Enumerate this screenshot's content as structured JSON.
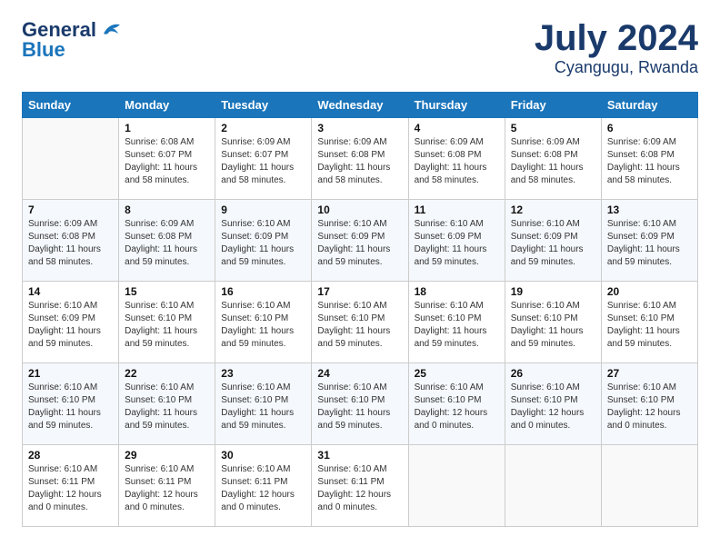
{
  "logo": {
    "general": "General",
    "blue": "Blue",
    "bird_unicode": "🐦"
  },
  "header": {
    "month_year": "July 2024",
    "location": "Cyangugu, Rwanda"
  },
  "days_of_week": [
    "Sunday",
    "Monday",
    "Tuesday",
    "Wednesday",
    "Thursday",
    "Friday",
    "Saturday"
  ],
  "weeks": [
    [
      {
        "day": "",
        "info": ""
      },
      {
        "day": "1",
        "info": "Sunrise: 6:08 AM\nSunset: 6:07 PM\nDaylight: 11 hours\nand 58 minutes."
      },
      {
        "day": "2",
        "info": "Sunrise: 6:09 AM\nSunset: 6:07 PM\nDaylight: 11 hours\nand 58 minutes."
      },
      {
        "day": "3",
        "info": "Sunrise: 6:09 AM\nSunset: 6:08 PM\nDaylight: 11 hours\nand 58 minutes."
      },
      {
        "day": "4",
        "info": "Sunrise: 6:09 AM\nSunset: 6:08 PM\nDaylight: 11 hours\nand 58 minutes."
      },
      {
        "day": "5",
        "info": "Sunrise: 6:09 AM\nSunset: 6:08 PM\nDaylight: 11 hours\nand 58 minutes."
      },
      {
        "day": "6",
        "info": "Sunrise: 6:09 AM\nSunset: 6:08 PM\nDaylight: 11 hours\nand 58 minutes."
      }
    ],
    [
      {
        "day": "7",
        "info": "Sunrise: 6:09 AM\nSunset: 6:08 PM\nDaylight: 11 hours\nand 58 minutes."
      },
      {
        "day": "8",
        "info": "Sunrise: 6:09 AM\nSunset: 6:08 PM\nDaylight: 11 hours\nand 59 minutes."
      },
      {
        "day": "9",
        "info": "Sunrise: 6:10 AM\nSunset: 6:09 PM\nDaylight: 11 hours\nand 59 minutes."
      },
      {
        "day": "10",
        "info": "Sunrise: 6:10 AM\nSunset: 6:09 PM\nDaylight: 11 hours\nand 59 minutes."
      },
      {
        "day": "11",
        "info": "Sunrise: 6:10 AM\nSunset: 6:09 PM\nDaylight: 11 hours\nand 59 minutes."
      },
      {
        "day": "12",
        "info": "Sunrise: 6:10 AM\nSunset: 6:09 PM\nDaylight: 11 hours\nand 59 minutes."
      },
      {
        "day": "13",
        "info": "Sunrise: 6:10 AM\nSunset: 6:09 PM\nDaylight: 11 hours\nand 59 minutes."
      }
    ],
    [
      {
        "day": "14",
        "info": "Sunrise: 6:10 AM\nSunset: 6:09 PM\nDaylight: 11 hours\nand 59 minutes."
      },
      {
        "day": "15",
        "info": "Sunrise: 6:10 AM\nSunset: 6:10 PM\nDaylight: 11 hours\nand 59 minutes."
      },
      {
        "day": "16",
        "info": "Sunrise: 6:10 AM\nSunset: 6:10 PM\nDaylight: 11 hours\nand 59 minutes."
      },
      {
        "day": "17",
        "info": "Sunrise: 6:10 AM\nSunset: 6:10 PM\nDaylight: 11 hours\nand 59 minutes."
      },
      {
        "day": "18",
        "info": "Sunrise: 6:10 AM\nSunset: 6:10 PM\nDaylight: 11 hours\nand 59 minutes."
      },
      {
        "day": "19",
        "info": "Sunrise: 6:10 AM\nSunset: 6:10 PM\nDaylight: 11 hours\nand 59 minutes."
      },
      {
        "day": "20",
        "info": "Sunrise: 6:10 AM\nSunset: 6:10 PM\nDaylight: 11 hours\nand 59 minutes."
      }
    ],
    [
      {
        "day": "21",
        "info": "Sunrise: 6:10 AM\nSunset: 6:10 PM\nDaylight: 11 hours\nand 59 minutes."
      },
      {
        "day": "22",
        "info": "Sunrise: 6:10 AM\nSunset: 6:10 PM\nDaylight: 11 hours\nand 59 minutes."
      },
      {
        "day": "23",
        "info": "Sunrise: 6:10 AM\nSunset: 6:10 PM\nDaylight: 11 hours\nand 59 minutes."
      },
      {
        "day": "24",
        "info": "Sunrise: 6:10 AM\nSunset: 6:10 PM\nDaylight: 11 hours\nand 59 minutes."
      },
      {
        "day": "25",
        "info": "Sunrise: 6:10 AM\nSunset: 6:10 PM\nDaylight: 12 hours\nand 0 minutes."
      },
      {
        "day": "26",
        "info": "Sunrise: 6:10 AM\nSunset: 6:10 PM\nDaylight: 12 hours\nand 0 minutes."
      },
      {
        "day": "27",
        "info": "Sunrise: 6:10 AM\nSunset: 6:10 PM\nDaylight: 12 hours\nand 0 minutes."
      }
    ],
    [
      {
        "day": "28",
        "info": "Sunrise: 6:10 AM\nSunset: 6:11 PM\nDaylight: 12 hours\nand 0 minutes."
      },
      {
        "day": "29",
        "info": "Sunrise: 6:10 AM\nSunset: 6:11 PM\nDaylight: 12 hours\nand 0 minutes."
      },
      {
        "day": "30",
        "info": "Sunrise: 6:10 AM\nSunset: 6:11 PM\nDaylight: 12 hours\nand 0 minutes."
      },
      {
        "day": "31",
        "info": "Sunrise: 6:10 AM\nSunset: 6:11 PM\nDaylight: 12 hours\nand 0 minutes."
      },
      {
        "day": "",
        "info": ""
      },
      {
        "day": "",
        "info": ""
      },
      {
        "day": "",
        "info": ""
      }
    ]
  ]
}
